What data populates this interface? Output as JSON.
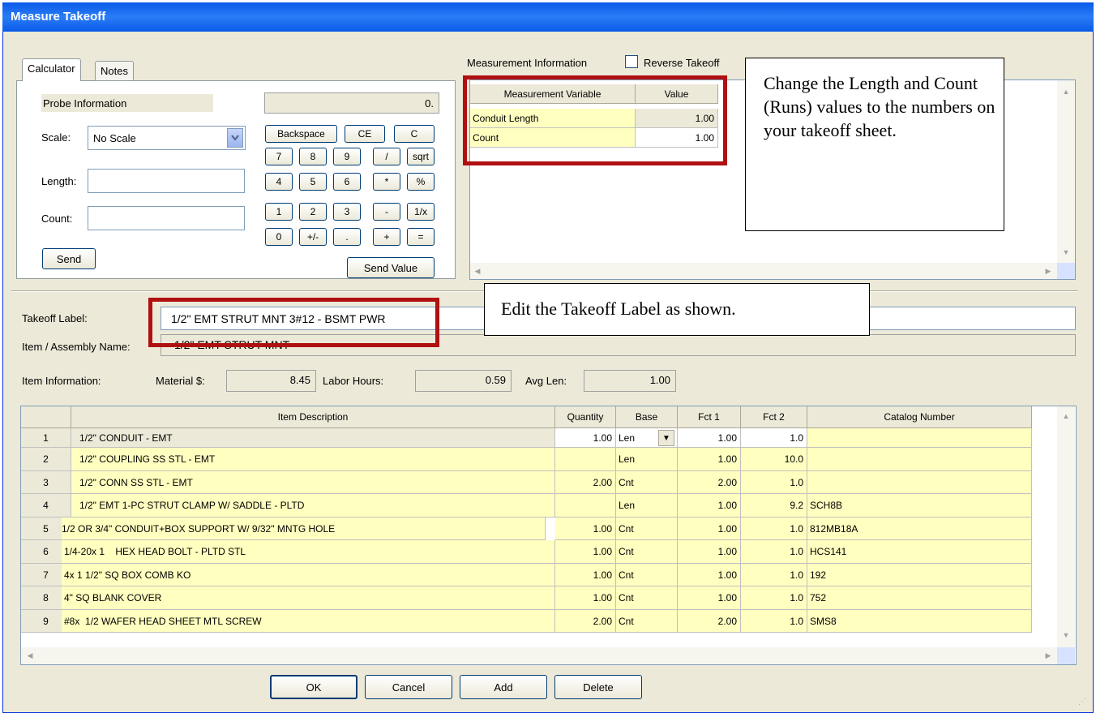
{
  "window": {
    "title": "Measure Takeoff"
  },
  "tabs": {
    "calculator": "Calculator",
    "notes": "Notes"
  },
  "calculator": {
    "probe_label": "Probe Information",
    "display_value": "0.",
    "scale_label": "Scale:",
    "scale_value": "No Scale",
    "length_label": "Length:",
    "length_value": "",
    "count_label": "Count:",
    "count_value": "",
    "send_label": "Send",
    "send_value_label": "Send Value",
    "keys": {
      "backspace": "Backspace",
      "ce": "CE",
      "c": "C",
      "k7": "7",
      "k8": "8",
      "k9": "9",
      "div": "/",
      "sqrt": "sqrt",
      "k4": "4",
      "k5": "5",
      "k6": "6",
      "mul": "*",
      "pct": "%",
      "k1": "1",
      "k2": "2",
      "k3": "3",
      "sub": "-",
      "inv": "1/x",
      "k0": "0",
      "sign": "+/-",
      "dot": ".",
      "add": "+",
      "eq": "="
    }
  },
  "measurement": {
    "section_label": "Measurement Information",
    "reverse_label": "Reverse Takeoff",
    "reverse_checked": false,
    "headers": {
      "variable": "Measurement Variable",
      "value": "Value"
    },
    "rows": [
      {
        "variable": "Conduit Length",
        "value": "1.00"
      },
      {
        "variable": "Count",
        "value": "1.00"
      }
    ]
  },
  "callouts": {
    "measurement_note": "Change the Length and Count (Runs) values to the numbers on your takeoff sheet.",
    "label_note": "Edit the Takeoff Label as shown."
  },
  "takeoff": {
    "label_caption": "Takeoff Label:",
    "label_value": "1/2\" EMT STRUT MNT 3#12 - BSMT PWR",
    "assembly_caption": "Item / Assembly Name:",
    "assembly_value": "1/2\" EMT STRUT MNT"
  },
  "item_info": {
    "caption": "Item Information:",
    "material_label": "Material $:",
    "material_value": "8.45",
    "labor_label": "Labor Hours:",
    "labor_value": "0.59",
    "avg_len_label": "Avg Len:",
    "avg_len_value": "1.00"
  },
  "items_table": {
    "headers": {
      "description": "Item Description",
      "quantity": "Quantity",
      "base": "Base",
      "fct1": "Fct 1",
      "fct2": "Fct 2",
      "catalog": "Catalog Number"
    },
    "rows": [
      {
        "n": "1",
        "description": "1/2\" CONDUIT - EMT",
        "quantity": "1.00",
        "base": "Len",
        "fct1": "1.00",
        "fct2": "1.0",
        "catalog": ""
      },
      {
        "n": "2",
        "description": "1/2\" COUPLING SS STL - EMT",
        "quantity": "",
        "base": "Len",
        "fct1": "1.00",
        "fct2": "10.0",
        "catalog": ""
      },
      {
        "n": "3",
        "description": "1/2\" CONN SS STL - EMT",
        "quantity": "2.00",
        "base": "Cnt",
        "fct1": "2.00",
        "fct2": "1.0",
        "catalog": ""
      },
      {
        "n": "4",
        "description": "1/2\" EMT 1-PC STRUT CLAMP W/ SADDLE - PLTD",
        "quantity": "",
        "base": "Len",
        "fct1": "1.00",
        "fct2": "9.2",
        "catalog": "SCH8B"
      },
      {
        "n": "5",
        "description": "1/2 OR 3/4\" CONDUIT+BOX SUPPORT W/ 9/32\" MNTG HOLE",
        "quantity": "1.00",
        "base": "Cnt",
        "fct1": "1.00",
        "fct2": "1.0",
        "catalog": "812MB18A"
      },
      {
        "n": "6",
        "description": "1/4-20x 1    HEX HEAD BOLT - PLTD STL",
        "quantity": "1.00",
        "base": "Cnt",
        "fct1": "1.00",
        "fct2": "1.0",
        "catalog": "HCS141"
      },
      {
        "n": "7",
        "description": "4x 1 1/2\" SQ BOX COMB KO",
        "quantity": "1.00",
        "base": "Cnt",
        "fct1": "1.00",
        "fct2": "1.0",
        "catalog": "192"
      },
      {
        "n": "8",
        "description": "4\" SQ BLANK COVER",
        "quantity": "1.00",
        "base": "Cnt",
        "fct1": "1.00",
        "fct2": "1.0",
        "catalog": "752"
      },
      {
        "n": "9",
        "description": "#8x  1/2 WAFER HEAD SHEET MTL SCREW",
        "quantity": "2.00",
        "base": "Cnt",
        "fct1": "2.00",
        "fct2": "1.0",
        "catalog": "SMS8"
      }
    ]
  },
  "buttons": {
    "ok": "OK",
    "cancel": "Cancel",
    "add": "Add",
    "delete": "Delete"
  },
  "icons": {
    "combo": "chevron-down-icon",
    "base_dropdown": "triangle-down-icon",
    "scroll_up": "scroll-up-icon",
    "scroll_down": "scroll-down-icon",
    "scroll_left": "scroll-left-icon",
    "scroll_right": "scroll-right-icon",
    "resize": "resize-grip-icon"
  },
  "colors": {
    "title_bar": "#0a5ae8",
    "window_bg": "#ece9d8",
    "editable_cell": "#ffffc0",
    "highlight_box": "#b01010"
  }
}
